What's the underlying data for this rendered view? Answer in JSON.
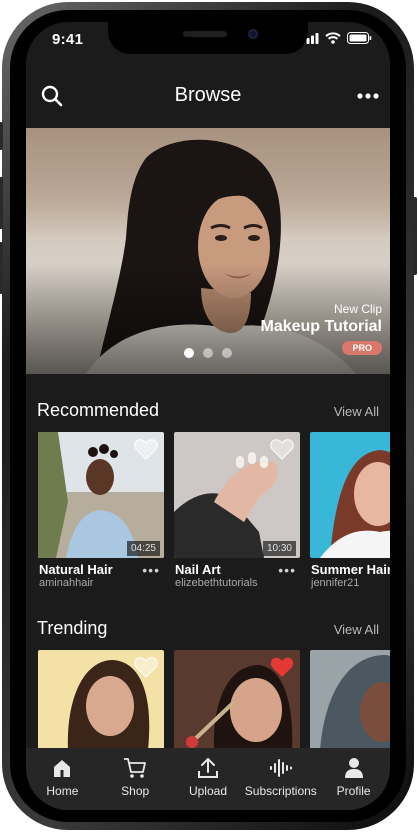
{
  "status": {
    "time": "9:41"
  },
  "header": {
    "title": "Browse"
  },
  "hero": {
    "subtitle": "New Clip",
    "title": "Makeup Tutorial",
    "badge": "PRO",
    "slides": 3,
    "active_slide": 1
  },
  "recommended": {
    "title": "Recommended",
    "view_all": "View All",
    "items": [
      {
        "title": "Natural Hair",
        "user": "aminahhair",
        "duration": "04:25",
        "liked": false
      },
      {
        "title": "Nail Art",
        "user": "elizebethtutorials",
        "duration": "10:30",
        "liked": false
      },
      {
        "title": "Summer Hair",
        "user": "jennifer21",
        "duration": "",
        "liked": false
      }
    ]
  },
  "trending": {
    "title": "Trending",
    "view_all": "View All",
    "items": [
      {
        "liked": false
      },
      {
        "liked": true
      },
      {
        "liked": false
      }
    ]
  },
  "tabs": [
    {
      "label": "Home",
      "icon": "home-icon"
    },
    {
      "label": "Shop",
      "icon": "cart-icon"
    },
    {
      "label": "Upload",
      "icon": "upload-icon"
    },
    {
      "label": "Subscriptions",
      "icon": "subscriptions-icon"
    },
    {
      "label": "Profile",
      "icon": "profile-icon"
    }
  ],
  "colors": {
    "background": "#1b1b1b",
    "tabbar": "#262626",
    "pro_badge": "#d9776b",
    "heart_active": "#e53935"
  }
}
